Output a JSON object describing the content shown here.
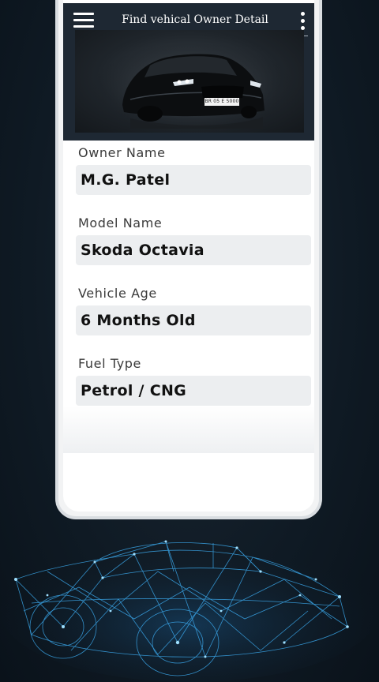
{
  "app": {
    "title": "Find vehical Owner Detail"
  },
  "header": {
    "menu_icon": "hamburger-menu-icon",
    "overflow_icon": "more-vertical-icon",
    "plate_text": "BR 05 E 5000"
  },
  "fields": [
    {
      "label": "Owner Name",
      "value": "M.G. Patel"
    },
    {
      "label": "Model Name",
      "value": "Skoda  Octavia"
    },
    {
      "label": "Vehicle Age",
      "value": "6  Months  Old"
    },
    {
      "label": "Fuel  Type",
      "value": "Petrol / CNG"
    }
  ],
  "colors": {
    "background": "#0f1a24",
    "header": "#1e2833",
    "field_bg": "#eceef0",
    "wireframe": "#3fb6ff"
  }
}
